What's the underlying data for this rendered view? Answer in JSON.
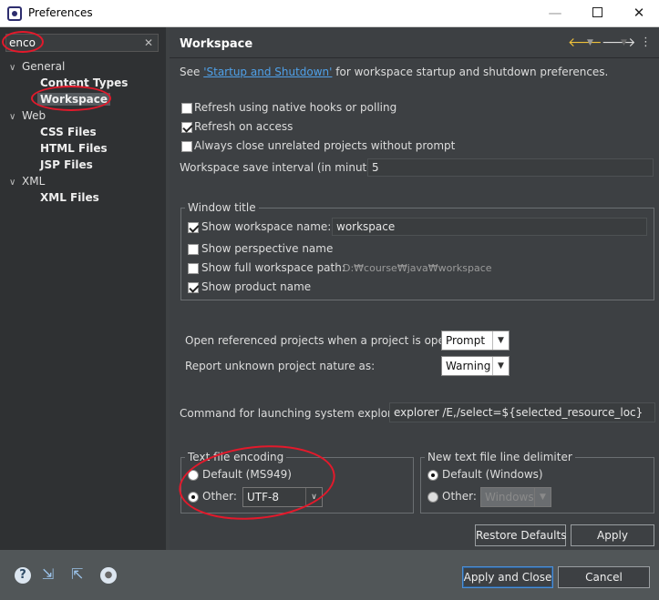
{
  "window": {
    "title": "Preferences",
    "minimize": "—",
    "close": "✕"
  },
  "filter": {
    "value": "enco",
    "clear": "✕"
  },
  "tree": {
    "expand": "∨",
    "groups": [
      {
        "label": "General",
        "children": [
          "Content Types",
          "Workspace"
        ]
      },
      {
        "label": "Web",
        "children": [
          "CSS Files",
          "HTML Files",
          "JSP Files"
        ]
      },
      {
        "label": "XML",
        "children": [
          "XML Files"
        ]
      }
    ]
  },
  "page": {
    "title": "Workspace",
    "nav_back": "🡐",
    "nav_dropdown": "▼",
    "nav_forward": "🡒",
    "view_menu": "⋮",
    "intro_prefix": "See ",
    "intro_link": "'Startup and Shutdown'",
    "intro_suffix": " for workspace startup and shutdown preferences.",
    "options": {
      "refresh_native": {
        "label": "Refresh using native hooks or polling",
        "checked": false
      },
      "refresh_access": {
        "label": "Refresh on access",
        "checked": true
      },
      "close_unrelated": {
        "label": "Always close unrelated projects without prompt",
        "checked": false
      }
    },
    "save_interval": {
      "label": "Workspace save interval (in minutes):",
      "value": "5"
    },
    "window_title": {
      "group_label": "Window title",
      "show_workspace_name": {
        "label": "Show workspace name:",
        "checked": true,
        "value": "workspace"
      },
      "show_perspective_name": {
        "label": "Show perspective name",
        "checked": false
      },
      "show_full_path": {
        "label": "Show full workspace path:",
        "checked": false,
        "value": "D:₩course₩java₩workspace"
      },
      "show_product_name": {
        "label": "Show product name",
        "checked": true
      }
    },
    "open_referenced": {
      "label": "Open referenced projects when a project is opened:",
      "value": "Prompt"
    },
    "report_unknown": {
      "label": "Report unknown project nature as:",
      "value": "Warning"
    },
    "system_explorer": {
      "label": "Command for launching system explorer:",
      "value": "explorer /E,/select=${selected_resource_loc}"
    },
    "text_encoding": {
      "group_label": "Text file encoding",
      "default_label": "Default (MS949)",
      "other_label": "Other:",
      "other_value": "UTF-8",
      "selected": "other"
    },
    "line_delimiter": {
      "group_label": "New text file line delimiter",
      "default_label": "Default (Windows)",
      "other_label": "Other:",
      "other_value": "Windows",
      "selected": "default"
    },
    "restore_defaults": "Restore Defaults",
    "apply": "Apply"
  },
  "footer": {
    "help_icon": "?",
    "import_icon": "⇲",
    "export_icon": "⇱",
    "record_icon": "●",
    "apply_close": "Apply and Close",
    "cancel": "Cancel"
  },
  "colors": {
    "annotation": "#e3192b",
    "link": "#4fa0e8",
    "panel_bg": "#3d4043",
    "tree_bg": "#2f3133"
  }
}
